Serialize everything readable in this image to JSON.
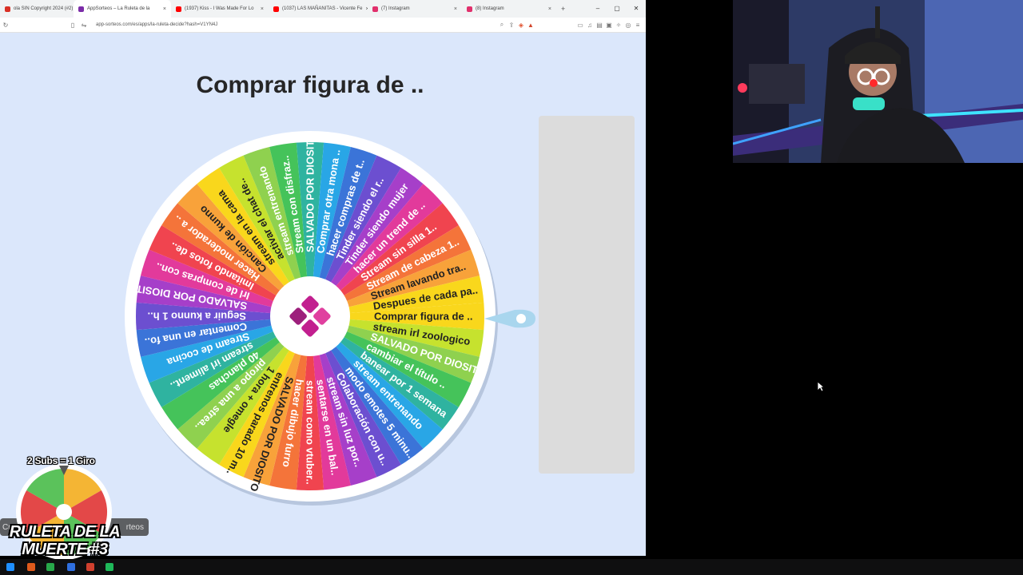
{
  "browser": {
    "tabs": [
      {
        "label": "ola SIN Copyright 2024 (#2)",
        "color": "#d93025",
        "active": false
      },
      {
        "label": "AppSorteos – La Ruleta de la",
        "color": "#7b2ca8",
        "active": true
      },
      {
        "label": "(1937) Kiss - I Was Made For Lo",
        "color": "#ff0000",
        "active": false
      },
      {
        "label": "(1037) LAS MAÑANITAS - Vicente Fe",
        "color": "#ff0000",
        "active": false
      },
      {
        "label": "(7) Instagram",
        "color": "#e1306c",
        "active": false
      },
      {
        "label": "(8) Instagram",
        "color": "#e1306c",
        "active": false
      }
    ],
    "new_tab_symbol": "+",
    "window_controls": [
      "‒",
      "▢",
      "✕"
    ],
    "url": "app-sorteos.com/es/apps/la-ruleta-decide?hash=V1YN4J"
  },
  "page": {
    "title": "Comprar figura de .."
  },
  "wheel": {
    "segments": [
      "Comprar figura de ..",
      "stream irl zoologico",
      "SALVADO POR DIOSITO",
      "cambiar el título ..",
      "banear por 1 semana",
      "stream entrenando",
      "modo emotes 5 minu..",
      "Colaboración con u..",
      "stream sin luz por..",
      "sentarse en un bal..",
      "stream como vtuber..",
      "hacer dibujo furro",
      "SALVADO POR DIOSITO",
      "entrenos parado 10 m..",
      "1 hora + omegle",
      "piropo a una strea..",
      "40 planchas",
      "stream irl aliment..",
      "Stream de cocina",
      "Comentar en una fo..",
      "Seguir a kunno 1 h..",
      "SALVADO POR DIOSITO",
      "Irl de compras con..",
      "Imitando fotos de..",
      "Hacer moderador a ..",
      "Canción de kunno",
      "stream en la cama",
      "activar el chat de..",
      "stream entrenando",
      "Stream con disfraz..",
      "SALVADO POR DIOSITO",
      "Comprar otra mona ..",
      "hacer compras de t..",
      "Tinder siendo el r..",
      "Tinder siendo mujer",
      "hacer un trend de ..",
      "Stream sin silla 1..",
      "Stream de cabeza 1..",
      "Stream lavando tra..",
      "Despues de cada pa.."
    ],
    "palette": [
      "#f9d71c",
      "#c6e22e",
      "#8fd14f",
      "#45c35a",
      "#2fb3a0",
      "#29a6e6",
      "#3b74d8",
      "#6c4fd0",
      "#a63fc9",
      "#e23a9b",
      "#f0444f",
      "#f4743a",
      "#f8a23a"
    ],
    "center_logo_color": "#c21f8f"
  },
  "overlay": {
    "subs_rule": "2 Subs = 1 Giro",
    "event_title": "RULETA DE LA MUERTE #3",
    "credit_left": "Cr",
    "credit_right": "rteos"
  }
}
